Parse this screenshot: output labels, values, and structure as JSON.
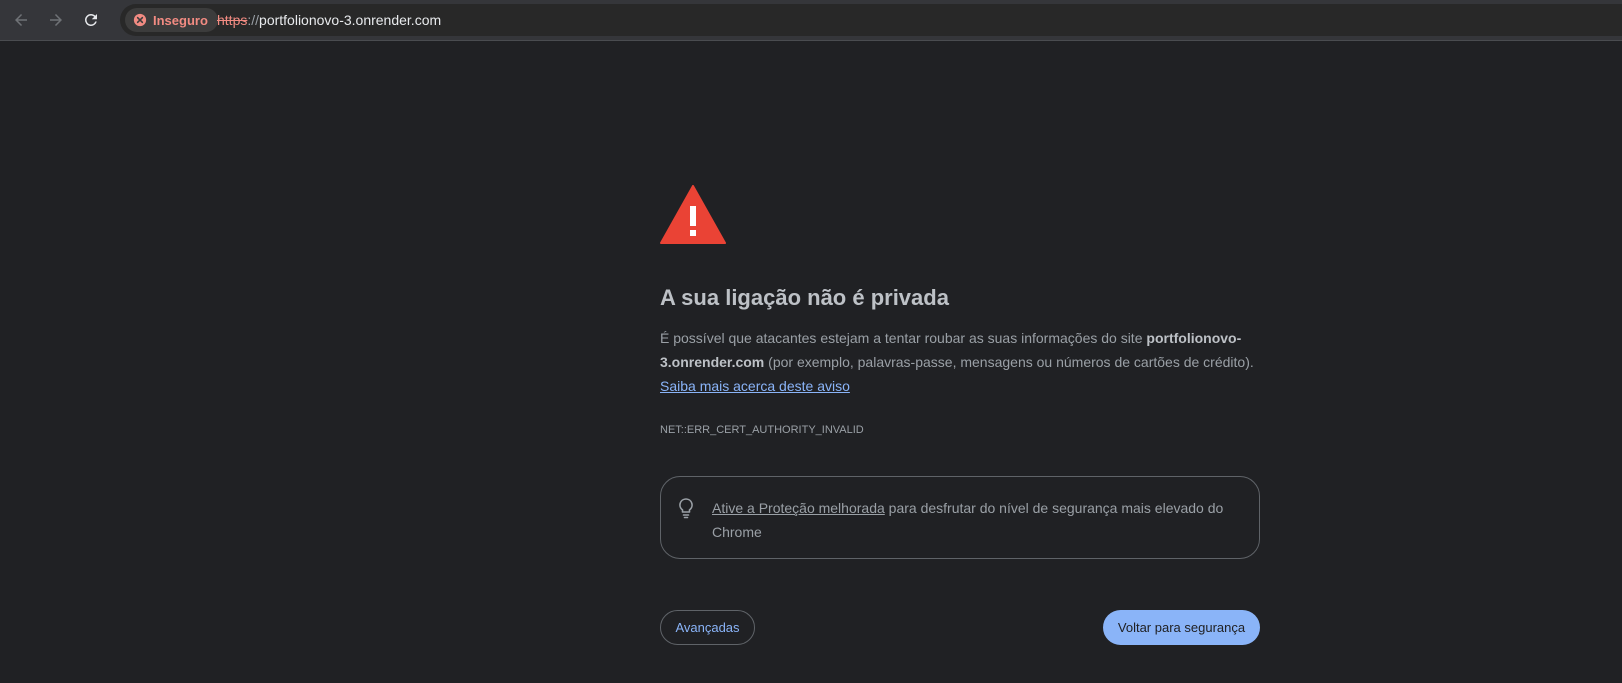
{
  "toolbar": {
    "back_icon": "arrow-left-icon",
    "forward_icon": "arrow-right-icon",
    "reload_icon": "reload-icon",
    "security_chip": {
      "icon": "insecure-icon",
      "label": "Inseguro",
      "color": "#f28b82"
    },
    "url": {
      "scheme": "https",
      "separator": "://",
      "host": "portfolionovo-3.onrender.com"
    }
  },
  "interstitial": {
    "icon": "warning-triangle-icon",
    "accent_color": "#ea4335",
    "title": "A sua ligação não é privada",
    "description": {
      "part1": "É possível que atacantes estejam a tentar roubar as suas informações do site",
      "host": "portfolionovo-3.onrender.com",
      "part2": "(por exemplo, palavras-passe, mensagens ou números de cartões de crédito).",
      "learn_more": "Saiba mais acerca deste aviso"
    },
    "error_code": "NET::ERR_CERT_AUTHORITY_INVALID",
    "enhanced_protection": {
      "icon": "lightbulb-icon",
      "link": "Ative a Proteção melhorada",
      "text": "para desfrutar do nível de segurança mais elevado do Chrome"
    },
    "buttons": {
      "advanced": "Avançadas",
      "back_to_safety": "Voltar para segurança"
    },
    "link_color": "#8ab4f8"
  }
}
